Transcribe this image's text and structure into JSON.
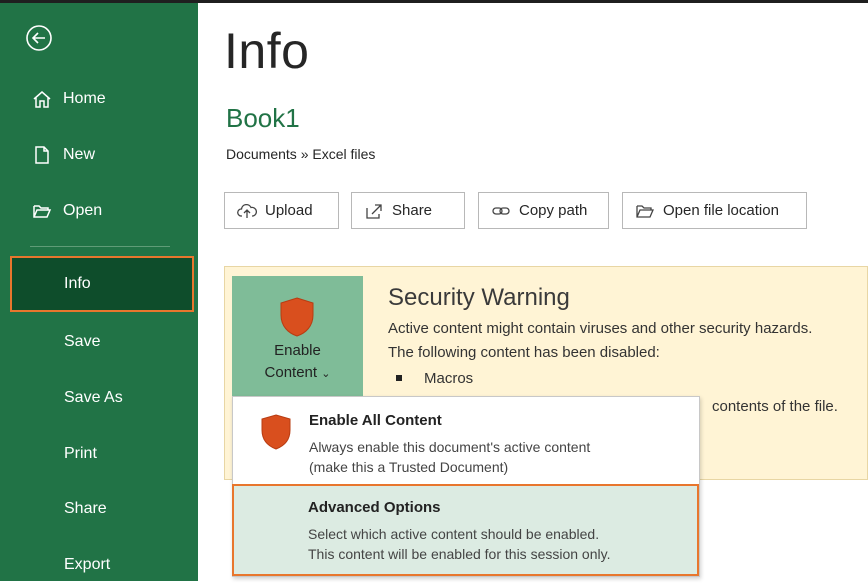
{
  "sidebar": {
    "home": "Home",
    "new": "New",
    "open": "Open",
    "info": "Info",
    "save": "Save",
    "save_as": "Save As",
    "print": "Print",
    "share": "Share",
    "export": "Export"
  },
  "main": {
    "title": "Info",
    "workbook": "Book1",
    "breadcrumb": "Documents » Excel files"
  },
  "actions": {
    "upload": "Upload",
    "share": "Share",
    "copy_path": "Copy path",
    "open_location": "Open file location"
  },
  "security": {
    "enable_line1": "Enable",
    "enable_line2": "Content",
    "title": "Security Warning",
    "line1": "Active content might contain viruses and other security hazards.",
    "line2": "The following content has been disabled:",
    "item1": "Macros",
    "line3": "contents of the file."
  },
  "menu": {
    "enable_all_title": "Enable All Content",
    "enable_all_desc1": "Always enable this document's active content",
    "enable_all_desc2": "(make this a Trusted Document)",
    "advanced_title": "Advanced Options",
    "advanced_desc1": "Select which active content should be enabled.",
    "advanced_desc2": "This content will be enabled for this session only."
  },
  "colors": {
    "sidebar": "#217346",
    "sidebar_active": "#0e4d2b",
    "highlight": "#e8762d",
    "warning_bg": "#fff4d5",
    "enable_button": "#7fbc98",
    "shield": "#d94f1e"
  }
}
